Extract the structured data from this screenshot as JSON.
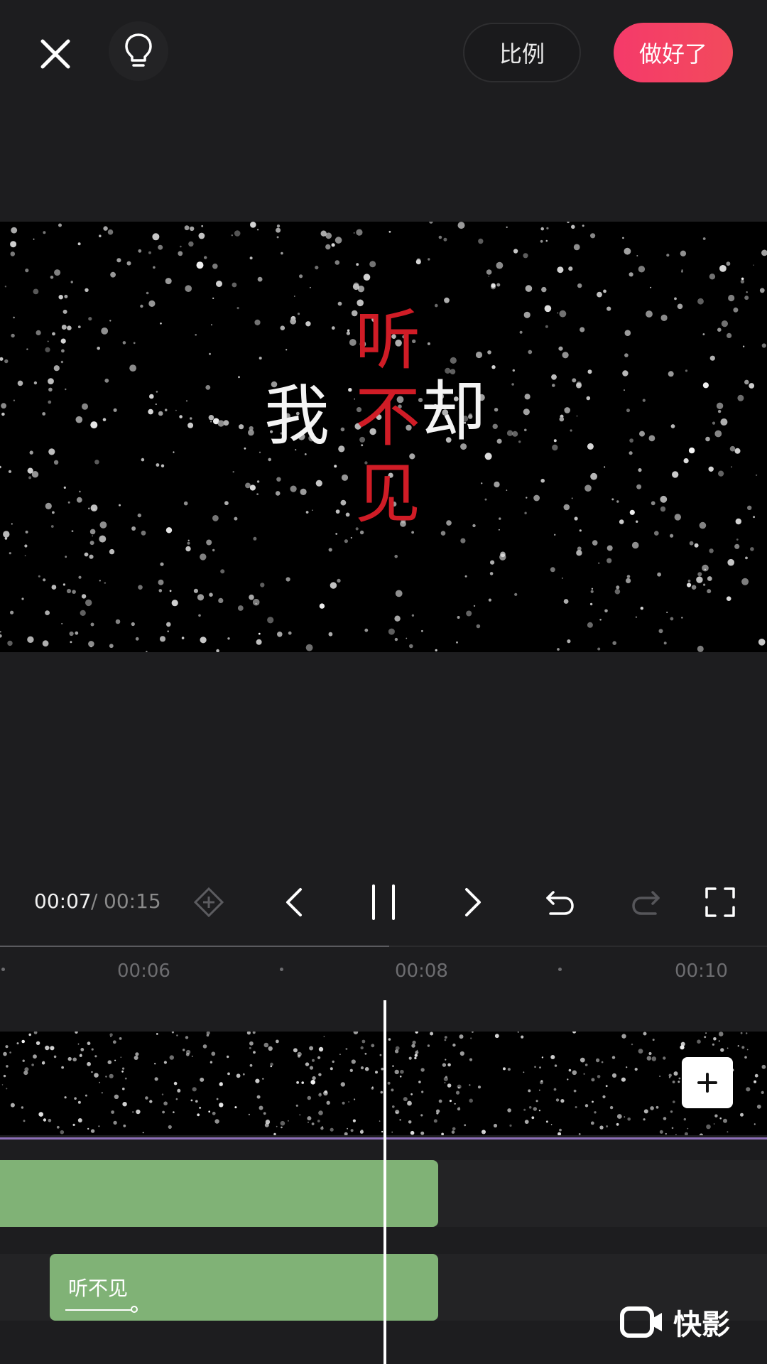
{
  "topbar": {
    "ratio_label": "比例",
    "done_label": "做好了",
    "done_color": "#f53a6a"
  },
  "preview": {
    "lyric": {
      "left": "我",
      "right": "却",
      "red_top": "听",
      "red_middle": "不",
      "red_bottom": "见"
    },
    "text_colors": {
      "white": "#f4f4f4",
      "red": "#d01c26"
    }
  },
  "controls": {
    "current_time": "00:07",
    "separator": "/",
    "total_time": "00:15",
    "icons": [
      "keyframe-icon",
      "prev-frame-icon",
      "pause-icon",
      "next-frame-icon",
      "undo-icon",
      "redo-icon",
      "fullscreen-icon"
    ]
  },
  "timeline": {
    "progress_fraction": 0.47,
    "ticks": [
      "00:06",
      "00:08",
      "00:10"
    ],
    "text_clip_label": "听不见",
    "clip_color": "#80b276"
  },
  "watermark": {
    "text": "快影"
  }
}
